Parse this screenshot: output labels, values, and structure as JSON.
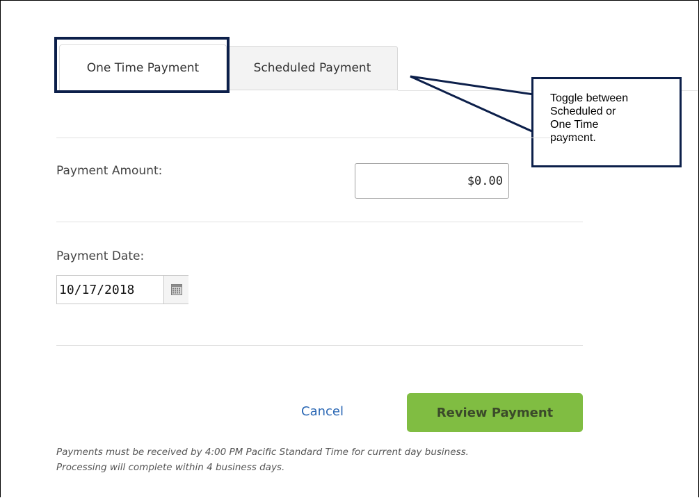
{
  "tabs": [
    {
      "label": "One Time Payment",
      "active": true
    },
    {
      "label": "Scheduled Payment",
      "active": false
    }
  ],
  "callout": {
    "lines": [
      "Toggle between",
      "Scheduled or",
      "One Time",
      "payment."
    ]
  },
  "form": {
    "amount_label": "Payment Amount:",
    "amount_value": "$0.00",
    "date_label": "Payment Date:",
    "date_value": "10/17/2018",
    "calendar_icon": "calendar-icon"
  },
  "actions": {
    "cancel_label": "Cancel",
    "review_label": "Review Payment"
  },
  "footnote": {
    "line1": "Payments must be received by 4:00 PM Pacific Standard Time for current day business.",
    "line2": "Processing will complete within 4 business days."
  },
  "colors": {
    "annotation_border": "#0c1f4a",
    "review_button": "#80bd42",
    "link": "#2a67b4"
  }
}
